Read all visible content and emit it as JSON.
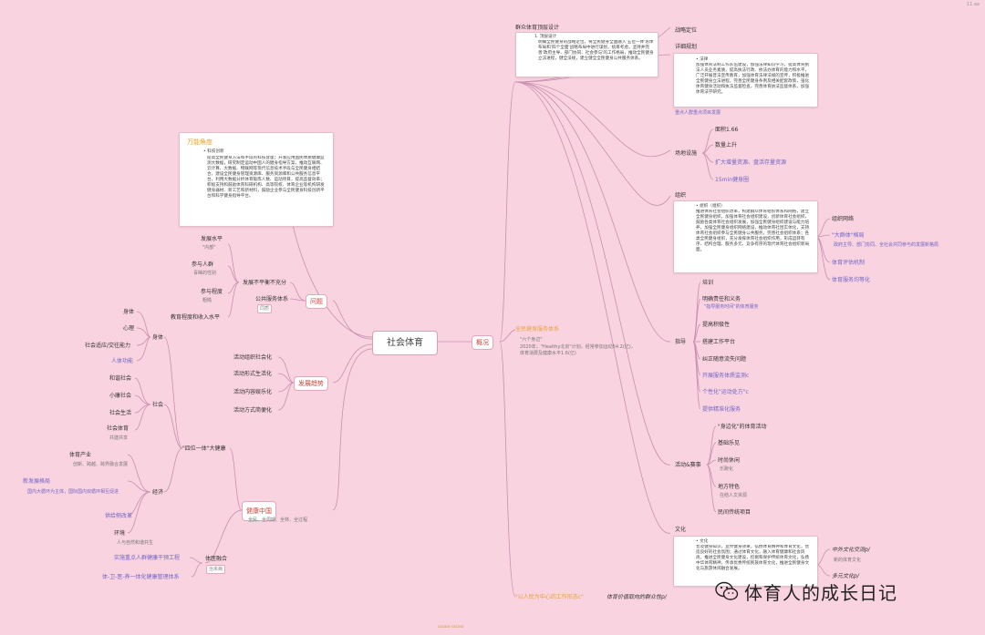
{
  "corner_label": "11 aa",
  "footer_note": "sasasa sasasa",
  "root": "社会体育",
  "branches": {
    "gaikuang": "概况",
    "wenti": "问题",
    "fazhan": "发展趋势",
    "jiankang": "健康中国"
  },
  "card_wanneng": {
    "title": "万能角度",
    "bullet": "• 科技创新",
    "body": "提高全民健身方法和手段的科技含量；开发应用国民体质健康监测大数据，研究制定运动中国人的健身指导方案，推动互联网、云计算、大数据、物联网等现代信息技术手段与全民健身相结合，建设全民健身管理资源库、服务资源库和公共服务信息平台，利用大数据分析体育锻炼人数、运动项目，提高监督效率；积极支持和鼓励体育科研机构、高等院校、体育企业等机构研发健身器材、新工艺和新材料，鼓励企业参与全民健身科技创新平台和科学健身指导平台。"
  },
  "card_top": {
    "title": "群众体育顶层设计",
    "bullet": "1. 顶层设计",
    "body": "明确全民健身的战略定位，将全民健身全面融入'五位一体'总体布局和'四个全面'战略布局中进行谋划，统筹考虑，坚持并完善'政府主导、部门协同、社会参与'的工作格局，推动全民健身立法进程，健全法规，建立健全全民健身公共服务体系。"
  },
  "card_xiangxi": {
    "bullet": "• 法律",
    "body": "加强体育法制工作队伍建设，加强法律知识学习，提高体育执法人员业务素质，提高执法行政、依法办体育的能力和水平，广泛开展普法宣传教育，加强体育法律法规的宣传，积极推进全民健身立法进程，完善全民健身条例及相关配套政策，强化体育健身活动和执法监督检查，完善体育执法监督体系，加强体育法学研究。"
  },
  "card_zuzhi": {
    "bullet": "• 组织（组织）",
    "body": "推进体育社会组织改革，构建群众体育组织体系和网络，建立全民健身组织，加强体育社会组织建设，创新体育社会组织，鼓励各类体育社会组织发展，加强全民健身组织建设与能力培养，加强全民健身组织网络建设，推动体育社团实体化，支持体育社会组织参与全民健身公共服务，完善社会组织体系；各类全民健身组织，充分发挥体育社会组织作用，形成运转有序、结构合理、服务多元、竞争有序的现代体育社会组织新局面。"
  },
  "card_wenhua": {
    "bullet": "• 文化",
    "body": "普及健身知识，宣传健身效果，弘扬体育精神和体育文化，营造良好的社会氛围；通过体育文化，融入体育健康和社会风尚，推进全民健身文化建设，挖掘和保护传统体育文化，弘扬中华体育精神，传承优秀传统民族体育文化，推进全民健身文化与旅游休闲融合发展。"
  },
  "right_top": {
    "zhanlue": "战略定位",
    "xiangxi": "详细规划",
    "zhongdian": "重点人群重点项目发展"
  },
  "changdi": {
    "label": "场地设施",
    "items": [
      "面积1.66",
      "数量上升",
      "扩大增量资源、盘活存量资源",
      "15min健身圈"
    ]
  },
  "zuzhi_label": "组织",
  "zuzhi_right": {
    "label": "组织网络",
    "items": [
      "\"大群体\"格局",
      "体育评估机制",
      "体育服务均等化"
    ],
    "note": "政府主导、部门协同、全社会共同参与的发展新格局"
  },
  "zhidao": {
    "label": "指导",
    "items": [
      "培训",
      "明确责任和义务",
      "提高积极性",
      "搭建工作平台",
      "纠正随意流失问题",
      "开展服务体质监测c",
      "个性化\"运动处方\"c",
      "提供精准化服务"
    ],
    "note": "\"指导服务时间\"的体育服务"
  },
  "huodong": {
    "label": "活动&赛事",
    "items": [
      "\"身边化\"的体育活动",
      "基础乐见",
      "时尚休闲",
      "地方特色",
      "民间传统项目"
    ],
    "note_shishang": "乐跑化",
    "note_difang": "在结人文资源"
  },
  "wenhua_label": "文化",
  "wenhua_right": {
    "items": [
      "中外文化交流p/",
      "多元文化p/"
    ],
    "note": "新的体育文化"
  },
  "qunzhong": {
    "title": "全民健身服务体系",
    "line1": "\"六个身边\"",
    "line2": "2020年，\"Healthy北京\"计划，经常参加运动54.2(亿)，体育消费及健康水平1.6(亿)",
    "bottom": "\"以人民为中心的工作形态c\"",
    "bottom2": "体育价值取向的群众性p/"
  },
  "wenti_items": {
    "fazhan": "发展不平衡不充分",
    "gonggong": "公共服务体系",
    "gonggong_note": "同质",
    "shuiping": "发展水平",
    "shuiping_note": "\"内部\"",
    "canyu": "参与人群",
    "canyu_note": "青睐的性别",
    "chengdu": "参与程度",
    "chengdu_note": "粗糙",
    "jiaoyu": "教育程度和收入水平"
  },
  "fazhan_items": [
    "活动组织社会化",
    "活动形式生活化",
    "活动内容娱乐化",
    "活动方式简便化"
  ],
  "jiankang": {
    "note": "全民、全周期、全林、全过程",
    "sitiyiti": "\"四位一体\"大健康",
    "shenti": "身体",
    "shenti_items": [
      "身体",
      "心理",
      "社会适应/交往能力"
    ],
    "renti": "人体功能",
    "shehui": "社会",
    "shehui_items": [
      "和谐社会",
      "小康社会",
      "社会生活",
      "社会体育"
    ],
    "shehui_note": "共建共享",
    "jingji": "经济",
    "chanye": "体育产业",
    "chanye_note": "创新、跨越、跨界融合发展",
    "xinfazhan": "新发展格局",
    "xinfazhan_note": "国内大循环为主体，国际国内双循环相互促进",
    "gongji": "供给侧改革",
    "huanjing": "环境",
    "huanjing_note": "人与自然和谐共生",
    "tiyi": "体医融合",
    "tiyi_note": "治未病",
    "shishi": "实施重点人群健康干预工程",
    "ti": "体-卫-医-养一体化健康管理体系"
  },
  "watermark": "体育人的成长日记",
  "colors": {
    "background": "#f9d3df",
    "branch_line": "#c98fb0",
    "accent_red": "#d0453a",
    "accent_orange": "#e6a23c",
    "accent_purple": "#7065c8"
  }
}
